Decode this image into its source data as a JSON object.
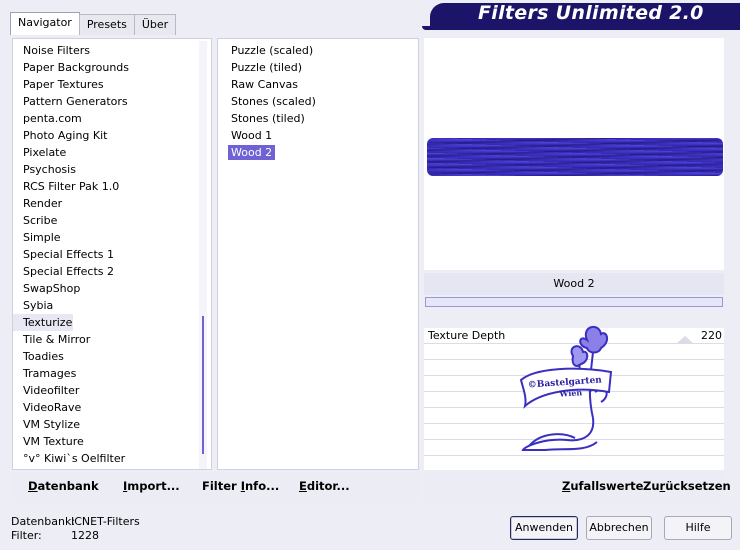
{
  "tabs": [
    {
      "label": "Navigator",
      "active": true
    },
    {
      "label": "Presets",
      "active": false
    },
    {
      "label": "Über",
      "active": false
    }
  ],
  "banner": {
    "title": "Filters Unlimited 2.0",
    "color": "#1c1468"
  },
  "categories": {
    "items": [
      "Noise Filters",
      "Paper Backgrounds",
      "Paper Textures",
      "Pattern Generators",
      "penta.com",
      "Photo Aging Kit",
      "Pixelate",
      "Psychosis",
      "RCS Filter Pak 1.0",
      "Render",
      "Scribe",
      "Simple",
      "Special Effects 1",
      "Special Effects 2",
      "SwapShop",
      "Sybia",
      "Texturize",
      "Tile & Mirror",
      "Toadies",
      "Tramages",
      "Videofilter",
      "VideoRave",
      "VM Stylize",
      "VM Texture",
      "°v° Kiwi`s Oelfilter"
    ],
    "selected": "Texturize"
  },
  "filters": {
    "items": [
      "Puzzle (scaled)",
      "Puzzle (tiled)",
      "Raw Canvas",
      "Stones (scaled)",
      "Stones (tiled)",
      "Wood 1",
      "Wood 2"
    ],
    "selected": "Wood 2"
  },
  "preview": {
    "filter_name": "Wood 2",
    "swatch_color": "#3a2fc0"
  },
  "params": [
    {
      "label": "Texture Depth",
      "value": "220"
    }
  ],
  "logo": {
    "line1": "©Bastelgarten",
    "line2": "Wien"
  },
  "links": {
    "datenbank": {
      "first": "D",
      "rest": "atenbank"
    },
    "import": {
      "first": "I",
      "rest": "mport..."
    },
    "filterinfo": {
      "pre": "Filter ",
      "first": "I",
      "rest": "nfo..."
    },
    "editor": {
      "first": "E",
      "rest": "ditor..."
    },
    "zufall": {
      "first": "Z",
      "rest": "ufallswerte"
    },
    "zurueck": {
      "pre": "Zu",
      "first": "r",
      "rest": "ücksetzen"
    }
  },
  "status": {
    "db_label": "Datenbank:",
    "db_value": "ICNET-Filters",
    "filter_label": "Filter:",
    "filter_value": "1228"
  },
  "buttons": {
    "apply": "Anwenden",
    "cancel": "Abbrechen",
    "help": "Hilfe"
  },
  "colors": {
    "accent": "#6e62d4",
    "banner": "#1c1468"
  }
}
